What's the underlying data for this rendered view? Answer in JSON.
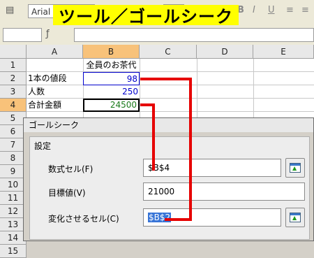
{
  "banner": {
    "title": "ツール／ゴールシーク"
  },
  "toolbar": {
    "font_name": "Arial"
  },
  "grid": {
    "columns": [
      "A",
      "B",
      "C",
      "D",
      "E"
    ],
    "rows": [
      "1",
      "2",
      "3",
      "4",
      "5",
      "6",
      "7",
      "8",
      "9",
      "10",
      "11",
      "12",
      "13",
      "14",
      "15"
    ],
    "cells": {
      "b1": "全員のお茶代",
      "a2": "1本の値段",
      "b2": "98",
      "a3": "人数",
      "b3": "250",
      "a4": "合計金額",
      "b4": "24500"
    }
  },
  "dialog": {
    "title": "ゴールシーク",
    "group_label": "設定",
    "formula_cell_label": "数式セル(F)",
    "formula_cell_value": "$B$4",
    "target_label": "目標値(V)",
    "target_value": "21000",
    "variable_cell_label": "変化させるセル(C)",
    "variable_cell_value": "$B$2"
  },
  "colors": {
    "selection_header": "#f8c27a",
    "highlight_banner": "#ffff00",
    "arrow": "#e60000"
  }
}
